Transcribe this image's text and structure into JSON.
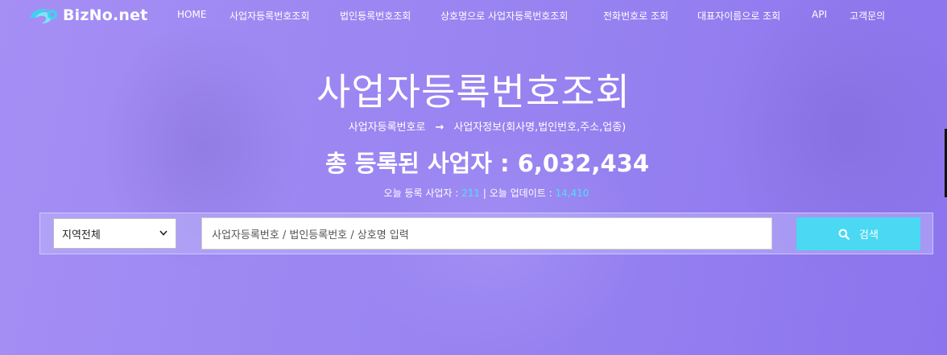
{
  "logo": {
    "text": "BizNo.net",
    "icon": "wave-logo-icon"
  },
  "nav": {
    "items": [
      "HOME",
      "사업자등록번호조회",
      "법인등록번호조회",
      "상호명으로 사업자등록번호조회",
      "전화번호로 조회",
      "대표자이름으로 조회",
      "API",
      "고객문의"
    ]
  },
  "hero": {
    "title": "사업자등록번호조회",
    "sub_from": "사업자등록번호로",
    "sub_arrow": "→",
    "sub_to": "사업자정보(회사명,법인번호,주소,업종)",
    "total_label": "총 등록된 사업자 : ",
    "total_value": "6,032,434",
    "today_label": "오늘 등록 사업자 : ",
    "today_value": "211",
    "sep": " | ",
    "update_label": "오늘 업데이트 : ",
    "update_value": "14,410"
  },
  "search": {
    "region_value": "지역전체",
    "placeholder": "사업자등록번호 / 법인등록번호 / 상호명 입력",
    "button_label": "검색",
    "button_icon": "search-icon"
  },
  "colors": {
    "accent": "#4ad8f2",
    "highlight_number": "#4fe0f5",
    "background": "#9c87f2"
  }
}
